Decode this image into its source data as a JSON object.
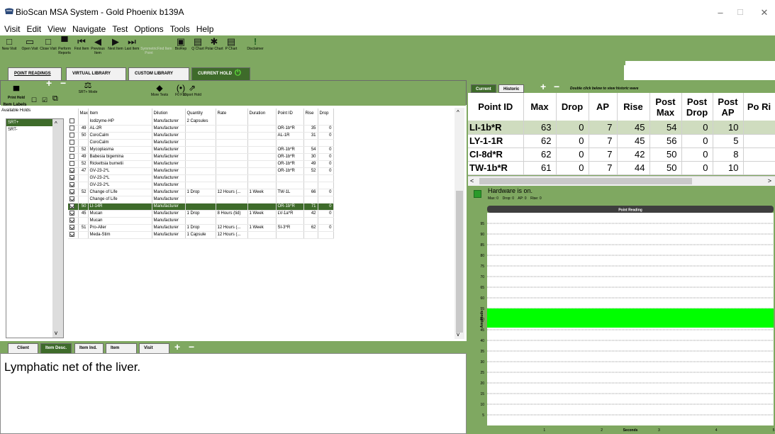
{
  "window": {
    "title": "BioScan MSA System - Gold Phoenix b139A",
    "min": "–",
    "max": "☐",
    "close": "✕"
  },
  "menu": [
    "Visit",
    "Edit",
    "View",
    "Navigate",
    "Test",
    "Options",
    "Tools",
    "Help"
  ],
  "toolbar": [
    {
      "label": "New Visit",
      "icon": "new-visit-icon"
    },
    {
      "label": "Open Visit",
      "icon": "open-visit-icon"
    },
    {
      "label": "Close Visit",
      "icon": "close-visit-icon"
    },
    {
      "label": "Perform Reports",
      "icon": "print-icon"
    },
    {
      "label": "First Item",
      "icon": "first-item-icon"
    },
    {
      "label": "Previous Item",
      "icon": "previous-item-icon"
    },
    {
      "label": "Next Item",
      "icon": "next-item-icon"
    },
    {
      "label": "Last Item",
      "icon": "last-item-icon"
    },
    {
      "label": "Symmetric Point",
      "icon": "symmetric-icon",
      "disabled": true
    },
    {
      "label": "Find Item",
      "icon": "find-icon",
      "disabled": true
    },
    {
      "label": "BioRep",
      "icon": "biorep-icon"
    },
    {
      "label": "Q Chart",
      "icon": "q-chart-icon"
    },
    {
      "label": "Polar Chart",
      "icon": "polar-chart-icon"
    },
    {
      "label": "P Chart",
      "icon": "p-chart-icon"
    },
    {
      "label": "Disclaimer",
      "icon": "disclaimer-icon"
    }
  ],
  "main_tabs": [
    {
      "label": "POINT READINGS"
    },
    {
      "label": "VIRTUAL LIBRARY"
    },
    {
      "label": "CUSTOM LIBRARY"
    },
    {
      "label": "CURRENT HOLD"
    }
  ],
  "holdbar": {
    "print_hold": "Print Hold",
    "item_labels": "Item Labels",
    "srt_mode": "SRT+ Mode",
    "more_tests": "More Tests",
    "f0_f10": "F0 F10",
    "export_hold": "Export Hold",
    "plus": "+",
    "minus": "−"
  },
  "available_holds": {
    "label": "Available Holds",
    "items": [
      "SRT+",
      "SRT-"
    ]
  },
  "item_table": {
    "columns": [
      "",
      "Max",
      "Item",
      "Dilution",
      "Quantity",
      "Rate",
      "Duration",
      "Point ID",
      "Rise",
      "Drop"
    ],
    "rows": [
      {
        "checked": false,
        "max": "",
        "item": "Iodizyme-HP",
        "dilution": "Manufacturer",
        "quantity": "2 Capsules",
        "rate": "",
        "duration": "",
        "point_id": "",
        "rise": "",
        "drop": ""
      },
      {
        "checked": false,
        "max": "49",
        "item": "AL-2R",
        "dilution": "Manufacturer",
        "quantity": "",
        "rate": "",
        "duration": "",
        "point_id": "OR-1b*R",
        "rise": "35",
        "drop": "0"
      },
      {
        "checked": false,
        "max": "50",
        "item": "CoroCalm",
        "dilution": "Manufacturer",
        "quantity": "",
        "rate": "",
        "duration": "",
        "point_id": "AL-1R",
        "rise": "31",
        "drop": "0"
      },
      {
        "checked": false,
        "max": "",
        "item": "CoroCalm",
        "dilution": "Manufacturer",
        "quantity": "",
        "rate": "",
        "duration": "",
        "point_id": "",
        "rise": "",
        "drop": ""
      },
      {
        "checked": false,
        "max": "52",
        "item": "Mycoplasma",
        "dilution": "Manufacturer",
        "quantity": "",
        "rate": "",
        "duration": "",
        "point_id": "OR-1b*R",
        "rise": "54",
        "drop": "0"
      },
      {
        "checked": false,
        "max": "49",
        "item": "Babesia bigemina",
        "dilution": "Manufacturer",
        "quantity": "",
        "rate": "",
        "duration": "",
        "point_id": "OR-1b*R",
        "rise": "30",
        "drop": "0"
      },
      {
        "checked": false,
        "max": "52",
        "item": "Rickettsia burnetii",
        "dilution": "Manufacturer",
        "quantity": "",
        "rate": "",
        "duration": "",
        "point_id": "OR-1b*R",
        "rise": "49",
        "drop": "0"
      },
      {
        "checked": true,
        "max": "47",
        "item": "GV-23-2*L",
        "dilution": "Manufacturer",
        "quantity": "",
        "rate": "",
        "duration": "",
        "point_id": "OR-1b*R",
        "rise": "52",
        "drop": "0"
      },
      {
        "checked": true,
        "max": "",
        "item": "GV-23-2*L",
        "dilution": "Manufacturer",
        "quantity": "",
        "rate": "",
        "duration": "",
        "point_id": "",
        "rise": "",
        "drop": ""
      },
      {
        "checked": true,
        "max": "",
        "item": "GV-23-2*L",
        "dilution": "Manufacturer",
        "quantity": "",
        "rate": "",
        "duration": "",
        "point_id": "",
        "rise": "",
        "drop": ""
      },
      {
        "checked": true,
        "max": "52",
        "item": "Change of Life",
        "dilution": "Manufacturer",
        "quantity": "1 Drop",
        "rate": "12 Hours (...",
        "duration": "1 Week",
        "point_id": "TW-1L",
        "rise": "66",
        "drop": "0"
      },
      {
        "checked": true,
        "max": "",
        "item": "Change of Life",
        "dilution": "Manufacturer",
        "quantity": "",
        "rate": "",
        "duration": "",
        "point_id": "",
        "rise": "",
        "drop": ""
      },
      {
        "checked": true,
        "max": "50",
        "item": "LI-14R",
        "dilution": "Manufacturer",
        "quantity": "",
        "rate": "",
        "duration": "",
        "point_id": "OR-1b*R",
        "rise": "71",
        "drop": "0",
        "selected": true
      },
      {
        "checked": true,
        "max": "45",
        "item": "Mucan",
        "dilution": "Manufacturer",
        "quantity": "1 Drop",
        "rate": "8 Hours (tid)",
        "duration": "1 Week",
        "point_id": "LV-1a*R",
        "rise": "42",
        "drop": "0"
      },
      {
        "checked": true,
        "max": "",
        "item": "Mucan",
        "dilution": "Manufacturer",
        "quantity": "",
        "rate": "",
        "duration": "",
        "point_id": "",
        "rise": "",
        "drop": ""
      },
      {
        "checked": true,
        "max": "51",
        "item": "Pro-Aller",
        "dilution": "Manufacturer",
        "quantity": "1 Drop",
        "rate": "12 Hours (...",
        "duration": "1 Week",
        "point_id": "SI-3*R",
        "rise": "62",
        "drop": "0"
      },
      {
        "checked": true,
        "max": "",
        "item": "Meda-Stim",
        "dilution": "Manufacturer",
        "quantity": "1 Capsule",
        "rate": "12 Hours (...",
        "duration": "",
        "point_id": "",
        "rise": "",
        "drop": ""
      }
    ]
  },
  "bottom_tabs": [
    {
      "label": "Client"
    },
    {
      "label": "Item Desc."
    },
    {
      "label": "Item Ind."
    },
    {
      "label": "Item Notes"
    },
    {
      "label": "Visit Notes"
    }
  ],
  "bottom_plus": "+",
  "bottom_minus": "−",
  "item_description": "Lymphatic net of the liver.",
  "right_tabs": {
    "current": "Current",
    "historic": "Historic",
    "hint": "Double click below to view historic wave",
    "plus": "+",
    "minus": "−"
  },
  "point_table": {
    "columns": [
      "Point ID",
      "Max",
      "Drop",
      "AP",
      "Rise",
      "Post Max",
      "Post Drop",
      "Post AP",
      "Po Ri"
    ],
    "rows": [
      [
        "LI-1b*R",
        "63",
        "0",
        "7",
        "45",
        "54",
        "0",
        "10",
        ""
      ],
      [
        "LY-1-1R",
        "62",
        "0",
        "7",
        "45",
        "56",
        "0",
        "5",
        ""
      ],
      [
        "CI-8d*R",
        "62",
        "0",
        "7",
        "42",
        "50",
        "0",
        "8",
        ""
      ],
      [
        "TW-1b*R",
        "61",
        "0",
        "7",
        "44",
        "50",
        "0",
        "10",
        ""
      ]
    ]
  },
  "hardware": {
    "status": "Hardware is on.",
    "max": "Max: 0",
    "drop": "Drop: 0",
    "ap": "AP: 0",
    "rise": "Rise: 0"
  },
  "chart_data": {
    "type": "area",
    "title": "Point Reading",
    "xlabel": "Seconds",
    "ylabel": "Amplitude",
    "xlim": [
      0,
      5
    ],
    "ylim": [
      0,
      100
    ],
    "x_ticks": [
      1,
      2,
      3,
      4,
      5
    ],
    "y_ticks": [
      5,
      10,
      15,
      20,
      25,
      30,
      35,
      40,
      45,
      50,
      55,
      60,
      65,
      70,
      75,
      80,
      85,
      90,
      95
    ],
    "band": {
      "low": 46,
      "high": 55,
      "color": "#00ff00"
    },
    "grid": true
  }
}
